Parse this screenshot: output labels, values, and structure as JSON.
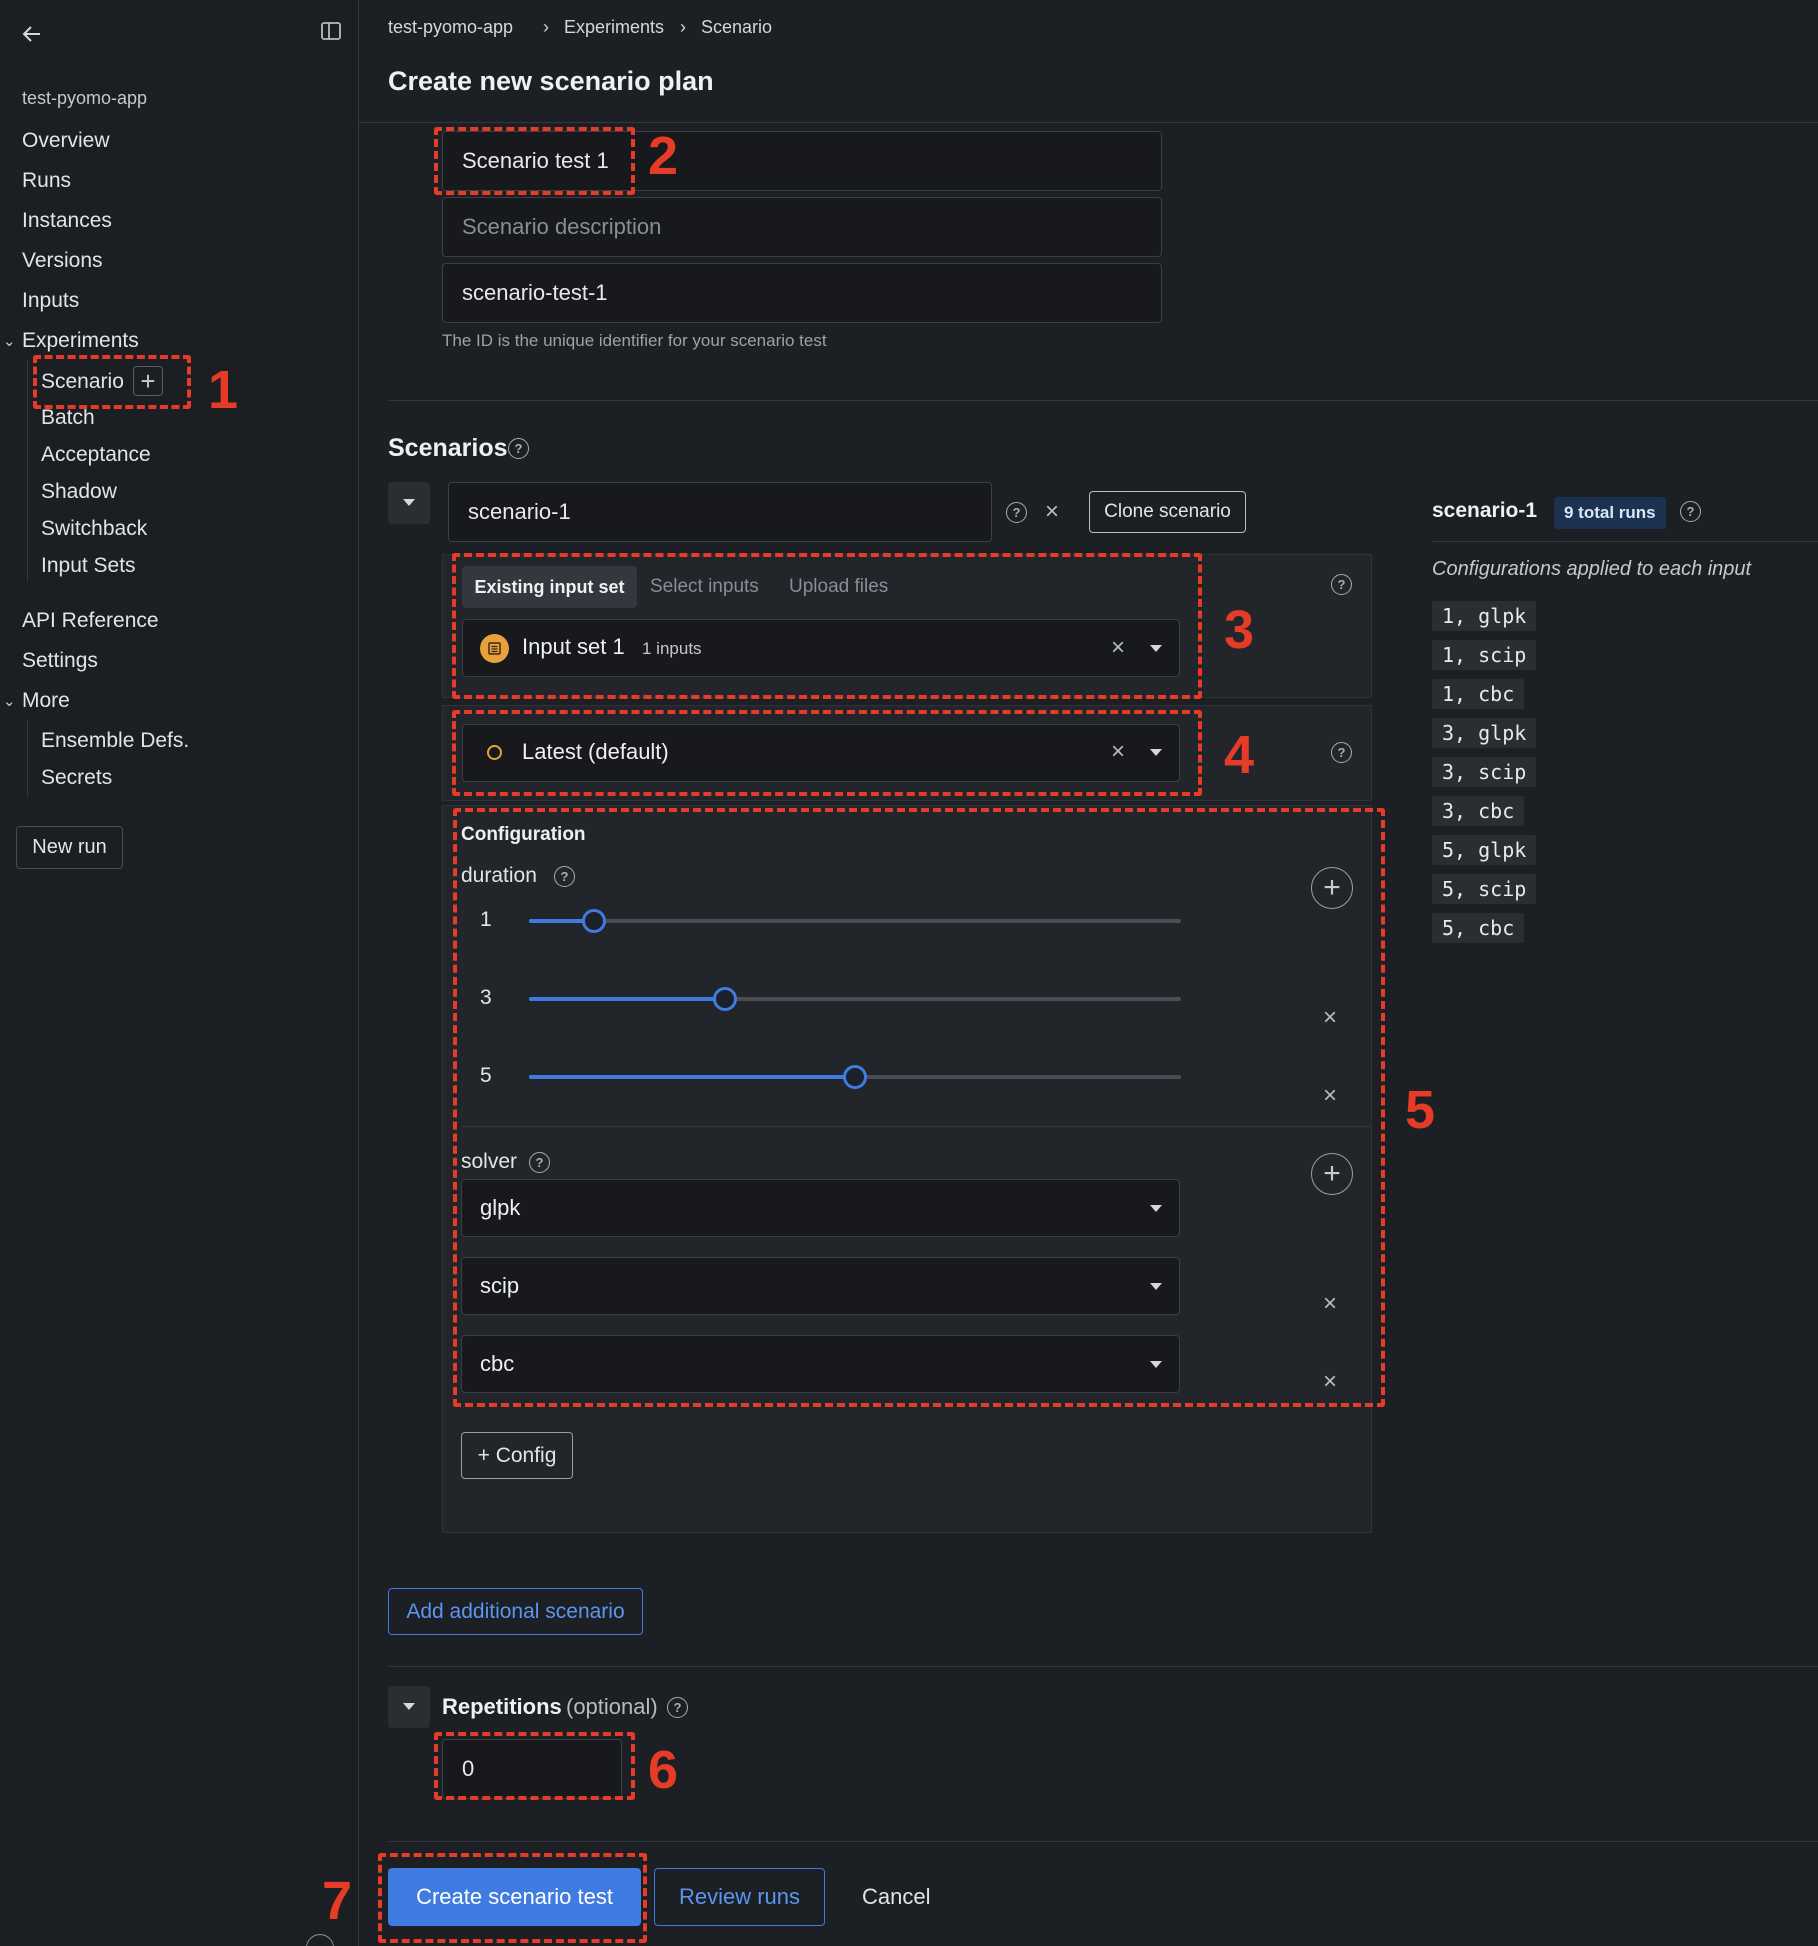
{
  "sidebar": {
    "app_name": "test-pyomo-app",
    "items": [
      "Overview",
      "Runs",
      "Instances",
      "Versions",
      "Inputs"
    ],
    "experiments_label": "Experiments",
    "experiments_items": [
      "Scenario",
      "Batch",
      "Acceptance",
      "Shadow",
      "Switchback",
      "Input Sets"
    ],
    "api_reference": "API Reference",
    "settings": "Settings",
    "more_label": "More",
    "more_items": [
      "Ensemble Defs.",
      "Secrets"
    ],
    "new_run": "New run"
  },
  "breadcrumb": [
    "test-pyomo-app",
    "Experiments",
    "Scenario"
  ],
  "page_title": "Create new scenario plan",
  "form": {
    "name_value": "Scenario test 1",
    "description_placeholder": "Scenario description",
    "id_value": "scenario-test-1",
    "id_help": "The ID is the unique identifier for your scenario test"
  },
  "scenarios": {
    "heading": "Scenarios",
    "scenario_name": "scenario-1",
    "clone_label": "Clone scenario",
    "input_tabs": [
      "Existing input set",
      "Select inputs",
      "Upload files"
    ],
    "active_tab": "Existing input set",
    "input_set_name": "Input set 1",
    "input_set_count": "1 inputs",
    "version": "Latest (default)",
    "configuration_title": "Configuration",
    "duration_label": "duration",
    "duration_values": [
      {
        "label": "1",
        "fraction": 0.1
      },
      {
        "label": "3",
        "fraction": 0.3
      },
      {
        "label": "5",
        "fraction": 0.5
      }
    ],
    "solver_label": "solver",
    "solver_values": [
      "glpk",
      "scip",
      "cbc"
    ],
    "add_config": "+ Config",
    "add_scenario": "Add additional scenario"
  },
  "summary": {
    "scenario_name": "scenario-1",
    "total_runs": "9 total runs",
    "caption": "Configurations applied to each input",
    "configs": [
      "1, glpk",
      "1, scip",
      "1, cbc",
      "3, glpk",
      "3, scip",
      "3, cbc",
      "5, glpk",
      "5, scip",
      "5, cbc"
    ]
  },
  "repetitions": {
    "label": "Repetitions",
    "optional": "(optional)",
    "value": "0"
  },
  "actions": {
    "create": "Create scenario test",
    "review": "Review runs",
    "cancel": "Cancel"
  },
  "annotations": [
    "1",
    "2",
    "3",
    "4",
    "5",
    "6",
    "7"
  ],
  "colors": {
    "accent": "#3f7be0",
    "annotation": "#e63b26",
    "background": "#1c1f24"
  }
}
